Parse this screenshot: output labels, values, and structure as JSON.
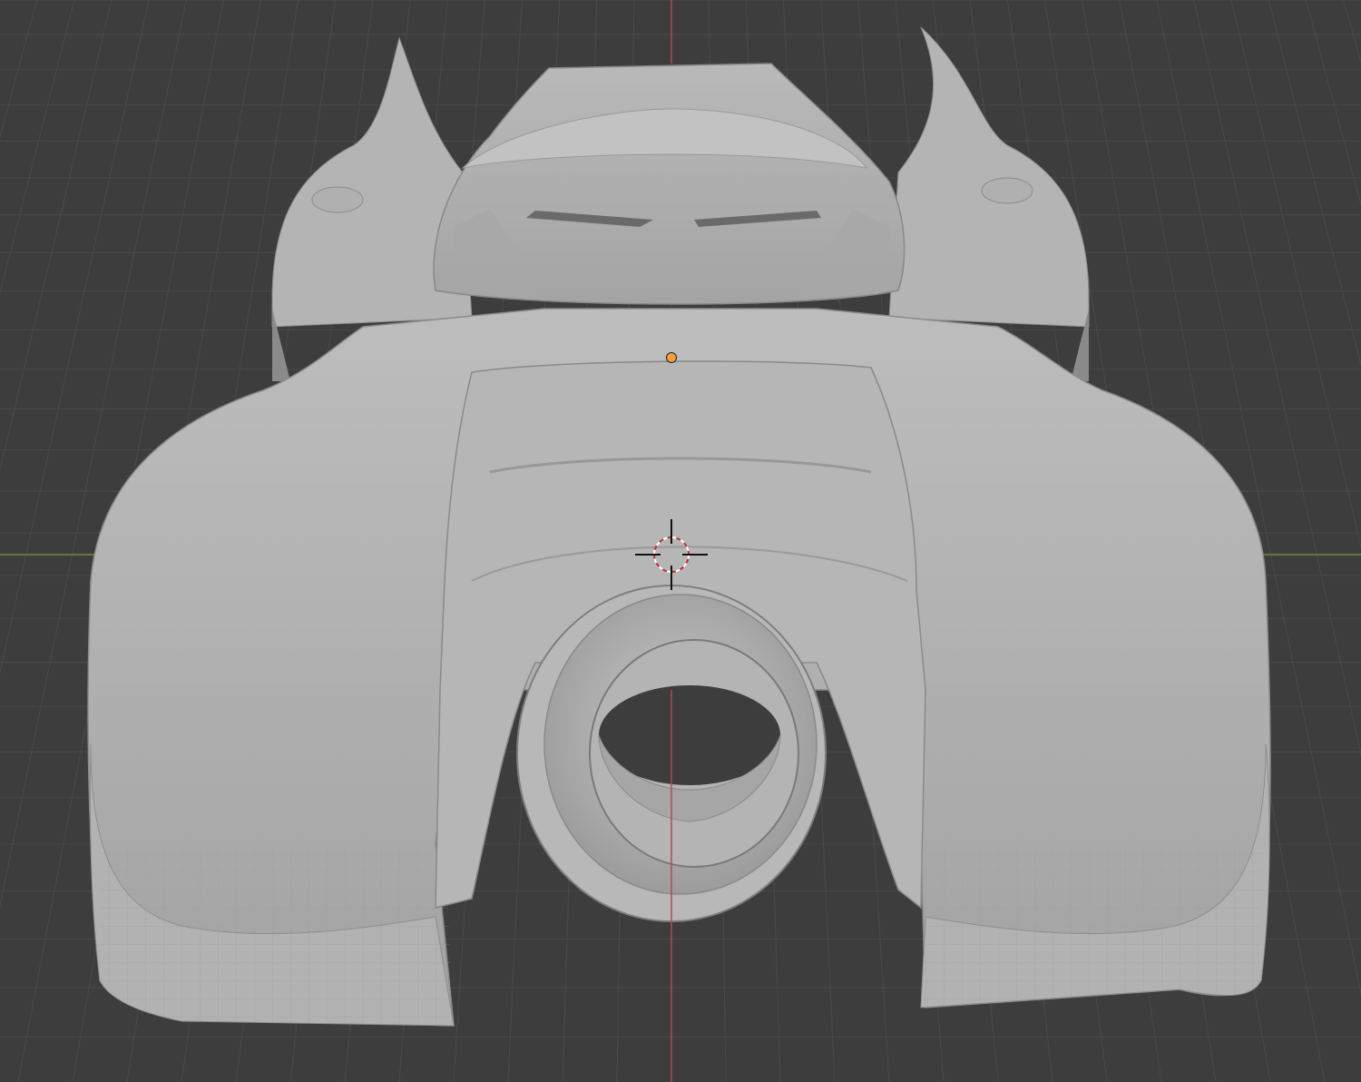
{
  "viewport": {
    "view": "3d-viewport",
    "shading": "solid",
    "object": "car-body-mesh",
    "overlays": {
      "grid_floor": true,
      "x_axis_line": true,
      "y_axis_line": true,
      "origin_point": true,
      "3d_cursor": true
    }
  },
  "colors": {
    "background": "#3d3d3d",
    "grid_line": "#4a4a4a",
    "x_axis": "#6e8c3e",
    "y_axis": "#b24a52",
    "mesh_base": "#a8a8a8",
    "mesh_light": "#c4c4c4",
    "mesh_shadow": "#8a8a8a",
    "origin_dot": "#f0a040",
    "cursor_ring_a": "#ffffff",
    "cursor_ring_b": "#c03030",
    "cursor_cross": "#111111"
  }
}
